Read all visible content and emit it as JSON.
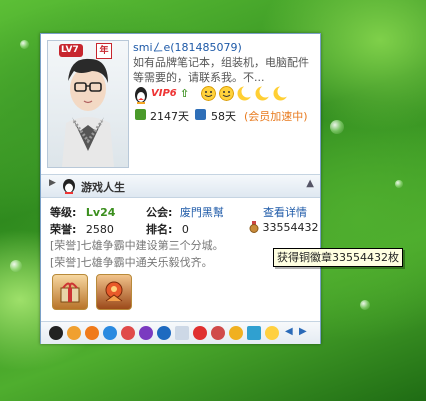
{
  "profile": {
    "level_badge": "LV7",
    "year_badge": "年",
    "nickname": "smiㄥe(181485079)",
    "signature": "如有品牌笔记本，组装机，电脑配件等需要的，请联系我。不...",
    "vip": "VIP6",
    "days_online": "2147天",
    "days_accel": "58天",
    "accel_note": "(会员加速中)"
  },
  "game": {
    "title": "游戏人生",
    "level_label": "等级:",
    "level_value": "Lv24",
    "guild_label": "公会:",
    "guild_value": "废門黑幫",
    "details_link": "查看详情",
    "honor_label": "荣誉:",
    "honor_value": "2580",
    "rank_label": "排名:",
    "rank_value": "0",
    "medal_count": "33554432",
    "honors": [
      "[荣誉]七雄争霸中建设第三个分城。",
      "[荣誉]七雄争霸中通关乐毅伐齐。"
    ]
  },
  "tooltip": "获得铜徽章33554432枚",
  "colors": {
    "border": "#7aa0c8",
    "link": "#1e5aa8",
    "accent_red": "#c7262e",
    "level_green": "#3b8f1e"
  },
  "icons": [
    "penguin-icon",
    "smiley-icon",
    "crescent-icon",
    "clock-icon",
    "medal-icon",
    "arrow-right-icon"
  ]
}
